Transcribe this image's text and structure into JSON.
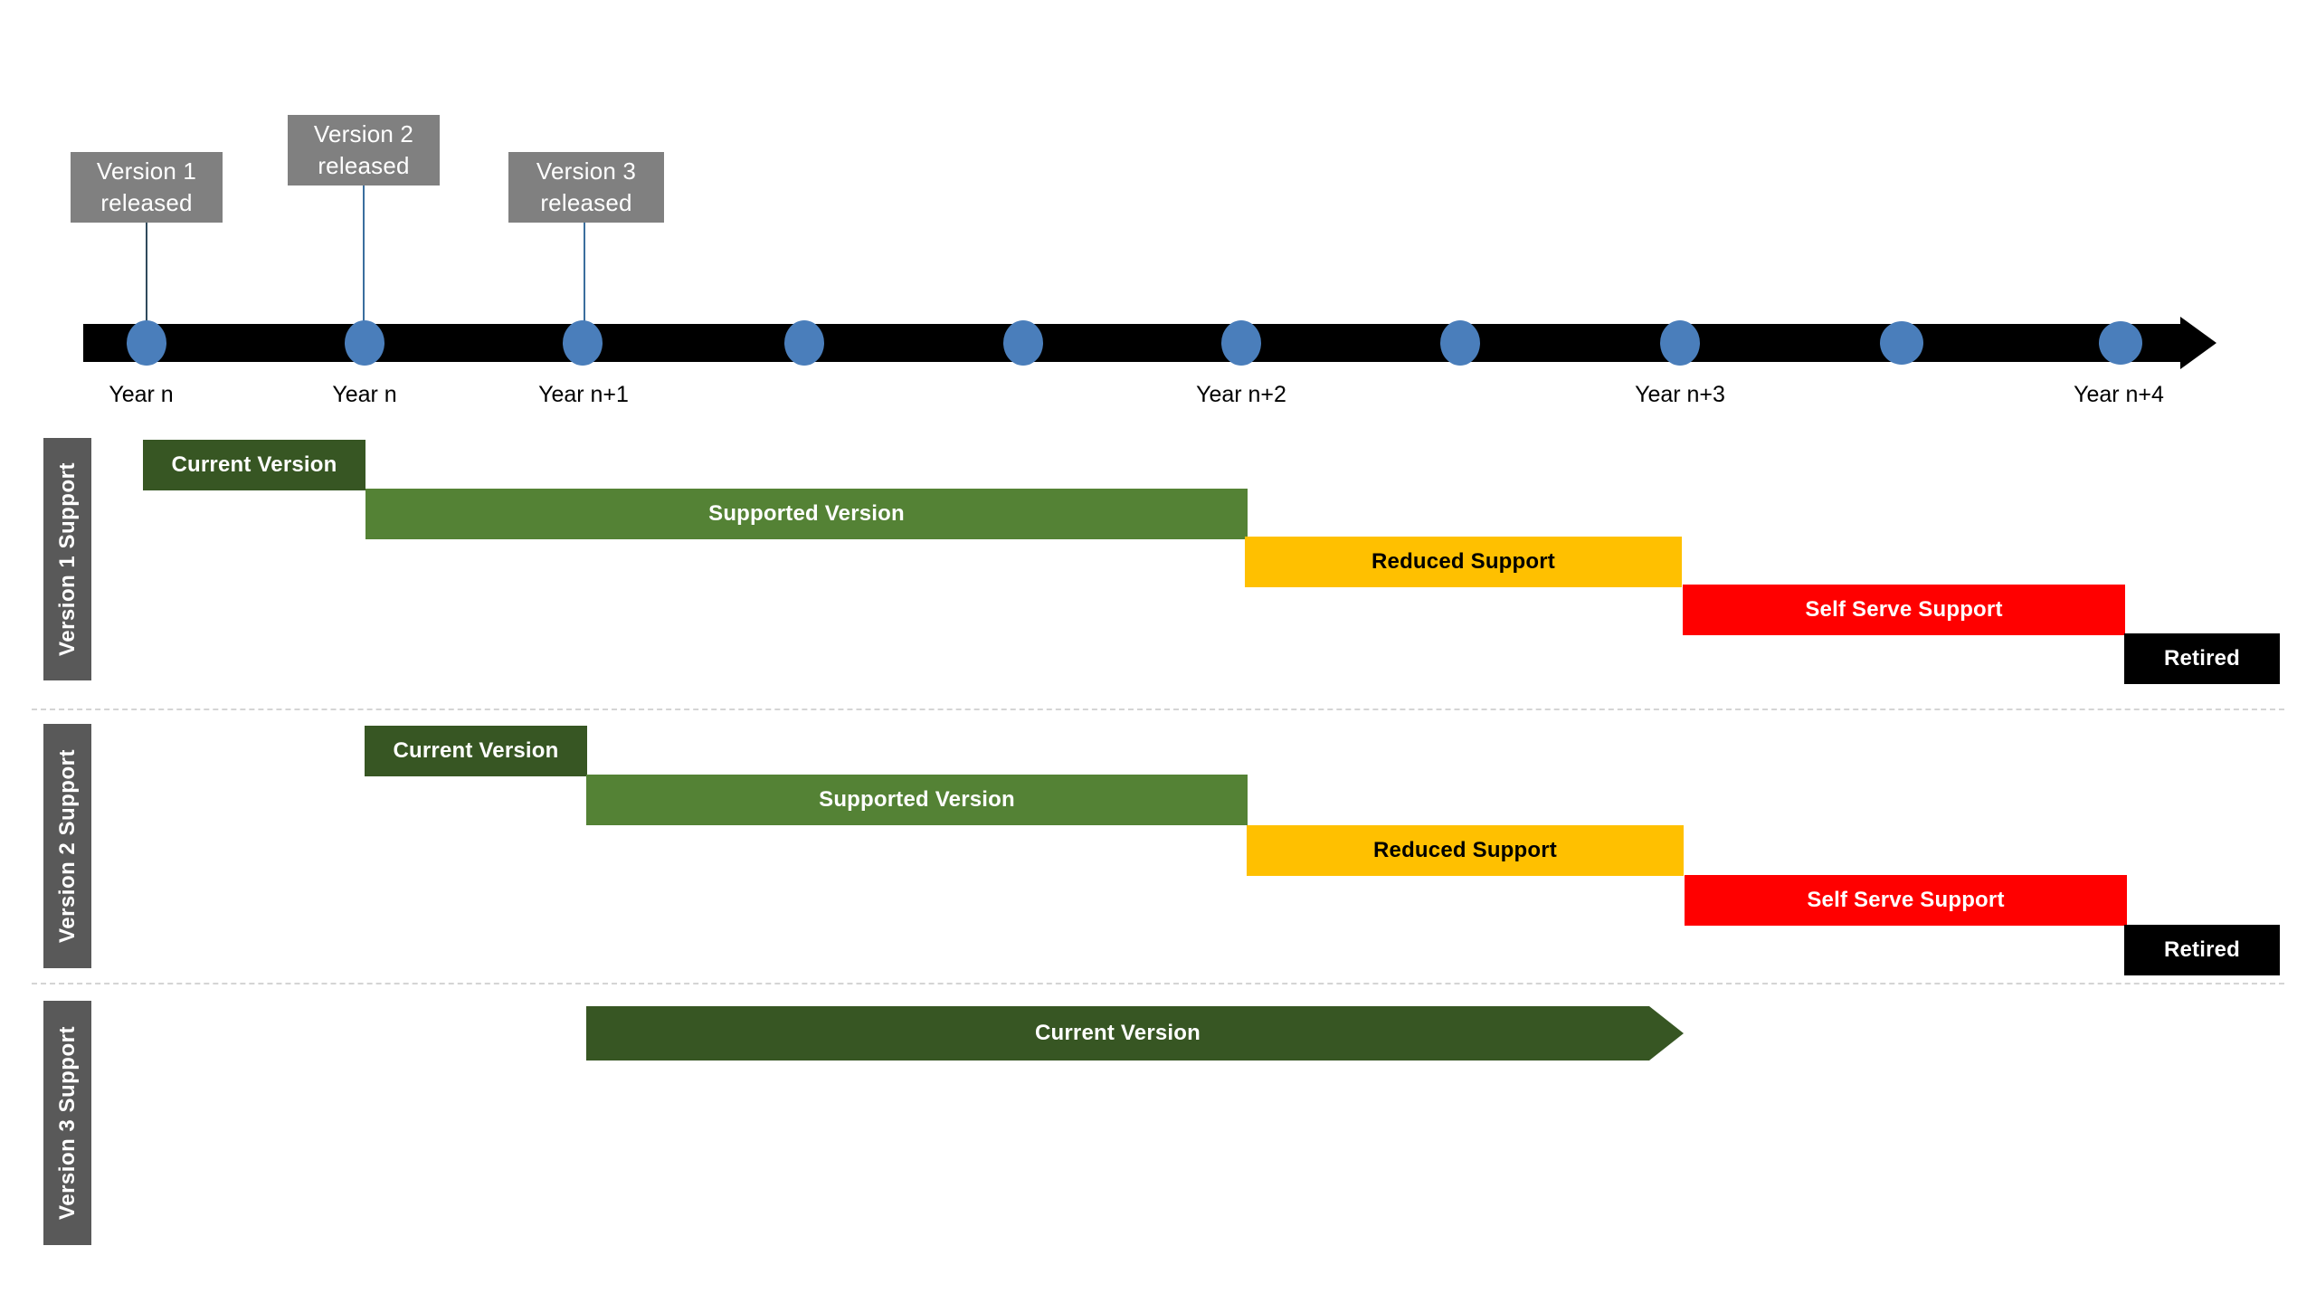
{
  "colors": {
    "callout_bg": "#808080",
    "timeline_bar": "#000000",
    "timeline_dot": "#4a7ebb",
    "side_label_bg": "#595959",
    "current_version": "#375623",
    "supported_version": "#548235",
    "reduced_support": "#FFC000",
    "self_serve_support": "#FF0000",
    "retired": "#000000",
    "divider": "#d4d4d4",
    "connector": "#3b6e9e"
  },
  "callouts": [
    {
      "id": "v1",
      "line1": "Version 1",
      "line2": "released"
    },
    {
      "id": "v2",
      "line1": "Version 2",
      "line2": "released"
    },
    {
      "id": "v3",
      "line1": "Version 3",
      "line2": "released"
    }
  ],
  "timeline": {
    "year_labels": [
      "Year n",
      "Year n",
      "Year n+1",
      "Year n+2",
      "Year n+3",
      "Year n+4"
    ],
    "markers": 10
  },
  "sections": [
    {
      "id": "version-1",
      "label": "Version 1 Support",
      "bars": [
        {
          "id": "v1-current",
          "label": "Current Version",
          "color": "#375623",
          "text_color": "#ffffff"
        },
        {
          "id": "v1-supported",
          "label": "Supported Version",
          "color": "#548235",
          "text_color": "#ffffff"
        },
        {
          "id": "v1-reduced",
          "label": "Reduced Support",
          "color": "#FFC000",
          "text_color": "#000000"
        },
        {
          "id": "v1-selfserve",
          "label": "Self Serve Support",
          "color": "#FF0000",
          "text_color": "#ffffff"
        },
        {
          "id": "v1-retired",
          "label": "Retired",
          "color": "#000000",
          "text_color": "#ffffff"
        }
      ]
    },
    {
      "id": "version-2",
      "label": "Version 2 Support",
      "bars": [
        {
          "id": "v2-current",
          "label": "Current Version",
          "color": "#375623",
          "text_color": "#ffffff"
        },
        {
          "id": "v2-supported",
          "label": "Supported Version",
          "color": "#548235",
          "text_color": "#ffffff"
        },
        {
          "id": "v2-reduced",
          "label": "Reduced Support",
          "color": "#FFC000",
          "text_color": "#000000"
        },
        {
          "id": "v2-selfserve",
          "label": "Self Serve Support",
          "color": "#FF0000",
          "text_color": "#ffffff"
        },
        {
          "id": "v2-retired",
          "label": "Retired",
          "color": "#000000",
          "text_color": "#ffffff"
        }
      ]
    },
    {
      "id": "version-3",
      "label": "Version 3 Support",
      "bars": [
        {
          "id": "v3-current",
          "label": "Current Version",
          "color": "#375623",
          "text_color": "#ffffff"
        }
      ]
    }
  ]
}
